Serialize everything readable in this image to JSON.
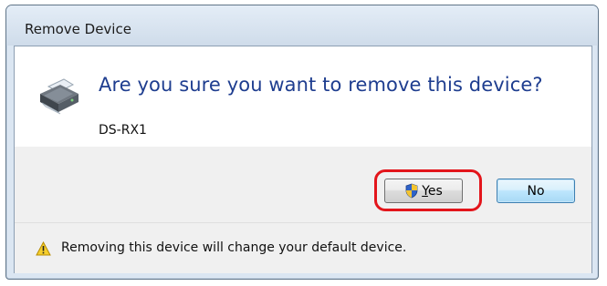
{
  "window": {
    "title": "Remove Device"
  },
  "main": {
    "question": "Are you sure you want to remove this device?",
    "device_name": "DS-RX1",
    "device_icon": "printer-icon"
  },
  "buttons": {
    "yes_label": "Yes",
    "no_label": "No",
    "yes_icon": "uac-shield-icon"
  },
  "footer": {
    "warning_icon": "warning-icon",
    "warning_text": "Removing this device will change your default device."
  },
  "colors": {
    "question_text": "#1e3d8f",
    "highlight": "#e3151b"
  }
}
